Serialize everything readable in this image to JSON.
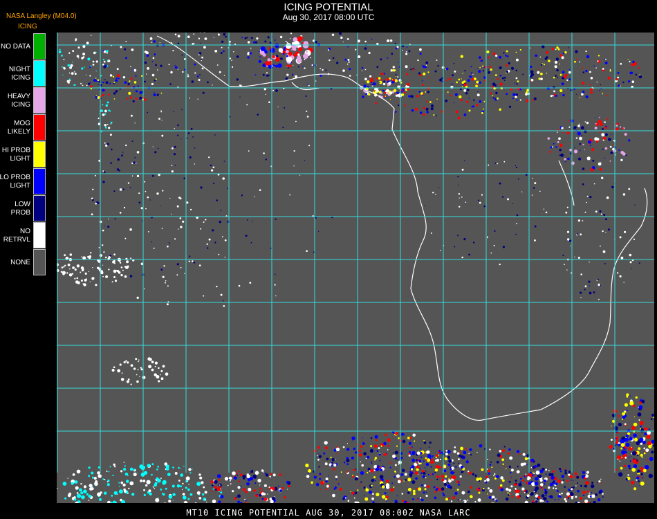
{
  "header": {
    "title": "ICING POTENTIAL",
    "subtitle": "Aug 30, 2017 08:00 UTC",
    "producer": "NASA Langley (M04.0)",
    "legend_title": "ICING"
  },
  "legend": [
    {
      "label": "NO DATA",
      "color": "#00b000"
    },
    {
      "label": "NIGHT\nICING",
      "color": "#00ffff"
    },
    {
      "label": "HEAVY\nICING",
      "color": "#e4a6e4"
    },
    {
      "label": "MOG\nLIKELY",
      "color": "#ff0000"
    },
    {
      "label": "HI PROB\nLIGHT",
      "color": "#ffff00"
    },
    {
      "label": "LO PROB\nLIGHT",
      "color": "#0000ff"
    },
    {
      "label": "LOW\nPROB",
      "color": "#000080"
    },
    {
      "label": "NO\nRETRVL",
      "color": "#ffffff"
    },
    {
      "label": "NONE",
      "color": "#555555"
    }
  ],
  "map": {
    "background_color": "#555555",
    "grid_color": "#33dddd",
    "coastline_color": "#ffffff",
    "grid": "on"
  },
  "footer": "MT10  ICING POTENTIAL   AUG 30, 2017 08:00Z   NASA LARC"
}
